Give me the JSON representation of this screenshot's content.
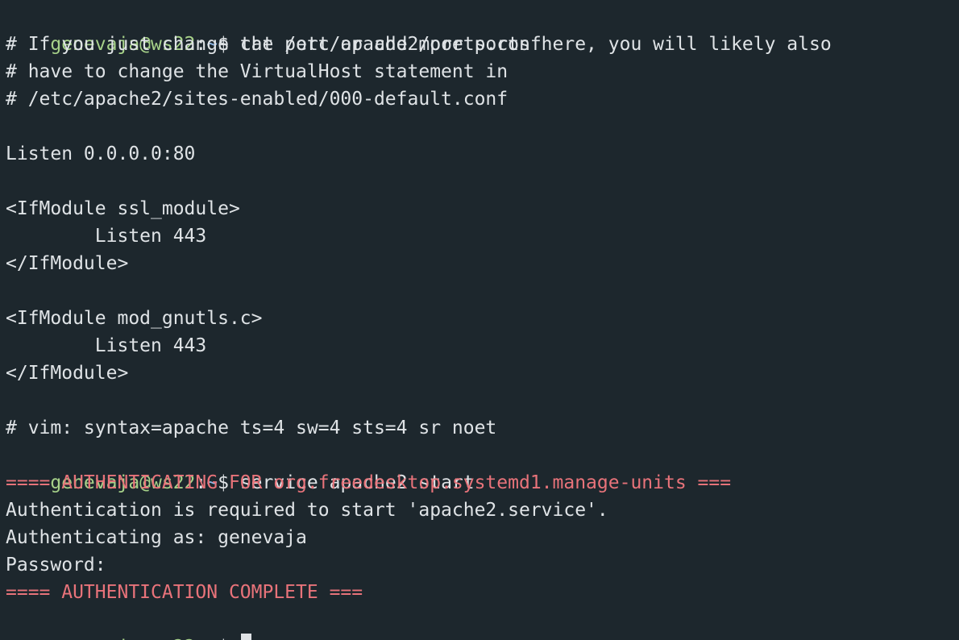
{
  "prompt": {
    "user_host": "genevaja@ws22",
    "colon": ":",
    "path": "~",
    "dollar": "$"
  },
  "lines": [
    {
      "type": "prompt",
      "command": " cat /etc/apache2/ports.conf"
    },
    {
      "type": "out",
      "text": "# If you just change the port or add more ports here, you will likely also"
    },
    {
      "type": "out",
      "text": "# have to change the VirtualHost statement in"
    },
    {
      "type": "out",
      "text": "# /etc/apache2/sites-enabled/000-default.conf"
    },
    {
      "type": "out",
      "text": ""
    },
    {
      "type": "out",
      "text": "Listen 0.0.0.0:80"
    },
    {
      "type": "out",
      "text": ""
    },
    {
      "type": "out",
      "text": "<IfModule ssl_module>"
    },
    {
      "type": "out",
      "text": "        Listen 443"
    },
    {
      "type": "out",
      "text": "</IfModule>"
    },
    {
      "type": "out",
      "text": ""
    },
    {
      "type": "out",
      "text": "<IfModule mod_gnutls.c>"
    },
    {
      "type": "out",
      "text": "        Listen 443"
    },
    {
      "type": "out",
      "text": "</IfModule>"
    },
    {
      "type": "out",
      "text": ""
    },
    {
      "type": "out",
      "text": "# vim: syntax=apache ts=4 sw=4 sts=4 sr noet"
    },
    {
      "type": "prompt",
      "command": " service apache2 start"
    },
    {
      "type": "red",
      "text": "==== AUTHENTICATING FOR org.freedesktop.systemd1.manage-units ==="
    },
    {
      "type": "out",
      "text": "Authentication is required to start 'apache2.service'."
    },
    {
      "type": "out",
      "text": "Authenticating as: genevaja"
    },
    {
      "type": "out",
      "text": "Password:"
    },
    {
      "type": "red",
      "text": "==== AUTHENTICATION COMPLETE ==="
    },
    {
      "type": "prompt",
      "command": " "
    }
  ],
  "colors": {
    "background": "#1d272d",
    "prompt_user": "#a6d189",
    "prompt_path": "#8fb8e8",
    "error_red": "#e8737a",
    "text": "#dfe3e6"
  }
}
